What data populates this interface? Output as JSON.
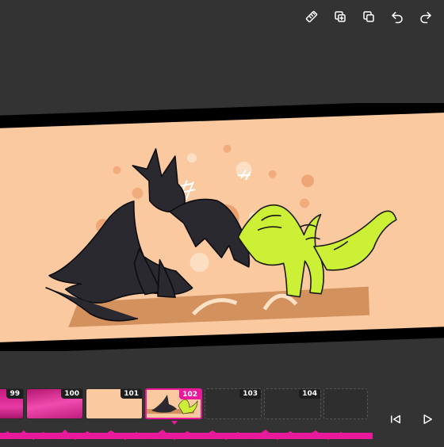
{
  "toolbar": {
    "icons": [
      "ruler-icon",
      "duplicate-frame-icon",
      "copy-icon",
      "undo-icon",
      "redo-icon"
    ]
  },
  "timeline": {
    "frames": [
      {
        "number": "99",
        "state": "filled"
      },
      {
        "number": "100",
        "state": "filled"
      },
      {
        "number": "101",
        "state": "filled"
      },
      {
        "number": "102",
        "state": "current"
      },
      {
        "number": "103",
        "state": "empty"
      },
      {
        "number": "104",
        "state": "empty"
      },
      {
        "number": "",
        "state": "empty"
      }
    ]
  },
  "controls": {
    "icons": [
      "skip-to-start-icon",
      "play-icon"
    ]
  },
  "colors": {
    "accent": "#e8199b",
    "background": "#333333",
    "canvas_bg": "#fbc9a0",
    "black_dragon": "#2a2930",
    "green_dragon": "#ccf035"
  }
}
